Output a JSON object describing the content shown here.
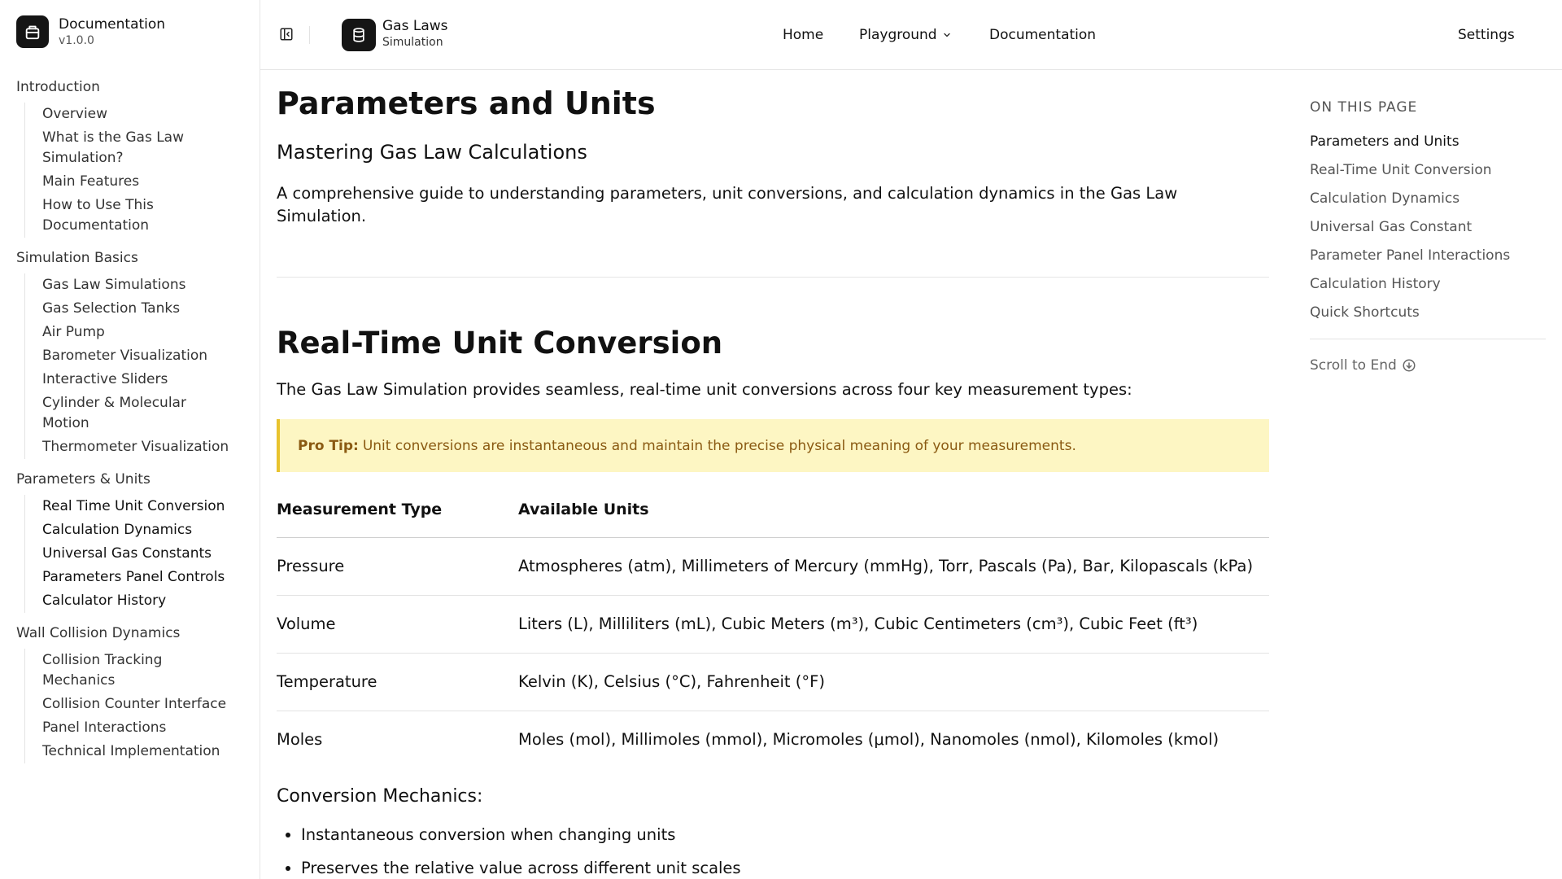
{
  "sidebar": {
    "brand_title": "Documentation",
    "brand_version": "v1.0.0",
    "groups": [
      {
        "title": "Introduction",
        "items": [
          "Overview",
          "What is the Gas Law Simulation?",
          "Main Features",
          "How to Use This Documentation"
        ]
      },
      {
        "title": "Simulation Basics",
        "items": [
          "Gas Law Simulations",
          "Gas Selection Tanks",
          "Air Pump",
          "Barometer Visualization",
          "Interactive Sliders",
          "Cylinder & Molecular Motion",
          "Thermometer Visualization"
        ]
      },
      {
        "title": "Parameters & Units",
        "items": [
          "Real Time Unit Conversion",
          "Calculation Dynamics",
          "Universal Gas Constants",
          "Parameters Panel Controls",
          "Calculator History"
        ]
      },
      {
        "title": "Wall Collision Dynamics",
        "items": [
          "Collision Tracking Mechanics",
          "Collision Counter Interface",
          "Panel Interactions",
          "Technical Implementation"
        ]
      }
    ]
  },
  "header": {
    "app_name": "Gas Laws",
    "app_sub": "Simulation",
    "nav": {
      "home": "Home",
      "playground": "Playground",
      "documentation": "Documentation"
    },
    "settings": "Settings"
  },
  "main": {
    "title": "Parameters and Units",
    "subtitle": "Mastering Gas Law Calculations",
    "intro": "A comprehensive guide to understanding parameters, unit conversions, and calculation dynamics in the Gas Law Simulation.",
    "section_title": "Real-Time Unit Conversion",
    "section_lead": "The Gas Law Simulation provides seamless, real-time unit conversions across four key measurement types:",
    "tip_label": "Pro Tip:",
    "tip_text": "Unit conversions are instantaneous and maintain the precise physical meaning of your measurements.",
    "table": {
      "headers": [
        "Measurement Type",
        "Available Units"
      ],
      "rows": [
        [
          "Pressure",
          "Atmospheres (atm), Millimeters of Mercury (mmHg), Torr, Pascals (Pa), Bar, Kilopascals (kPa)"
        ],
        [
          "Volume",
          "Liters (L), Milliliters (mL), Cubic Meters (m³), Cubic Centimeters (cm³), Cubic Feet (ft³)"
        ],
        [
          "Temperature",
          "Kelvin (K), Celsius (°C), Fahrenheit (°F)"
        ],
        [
          "Moles",
          "Moles (mol), Millimoles (mmol), Micromoles (μmol), Nanomoles (nmol), Kilomoles (kmol)"
        ]
      ]
    },
    "mechanics_title": "Conversion Mechanics:",
    "mechanics": [
      "Instantaneous conversion when changing units",
      "Preserves the relative value across different unit scales"
    ]
  },
  "toc": {
    "title": "ON THIS PAGE",
    "items": [
      "Parameters and Units",
      "Real-Time Unit Conversion",
      "Calculation Dynamics",
      "Universal Gas Constant",
      "Parameter Panel Interactions",
      "Calculation History",
      "Quick Shortcuts"
    ],
    "scroll_end": "Scroll to End"
  }
}
